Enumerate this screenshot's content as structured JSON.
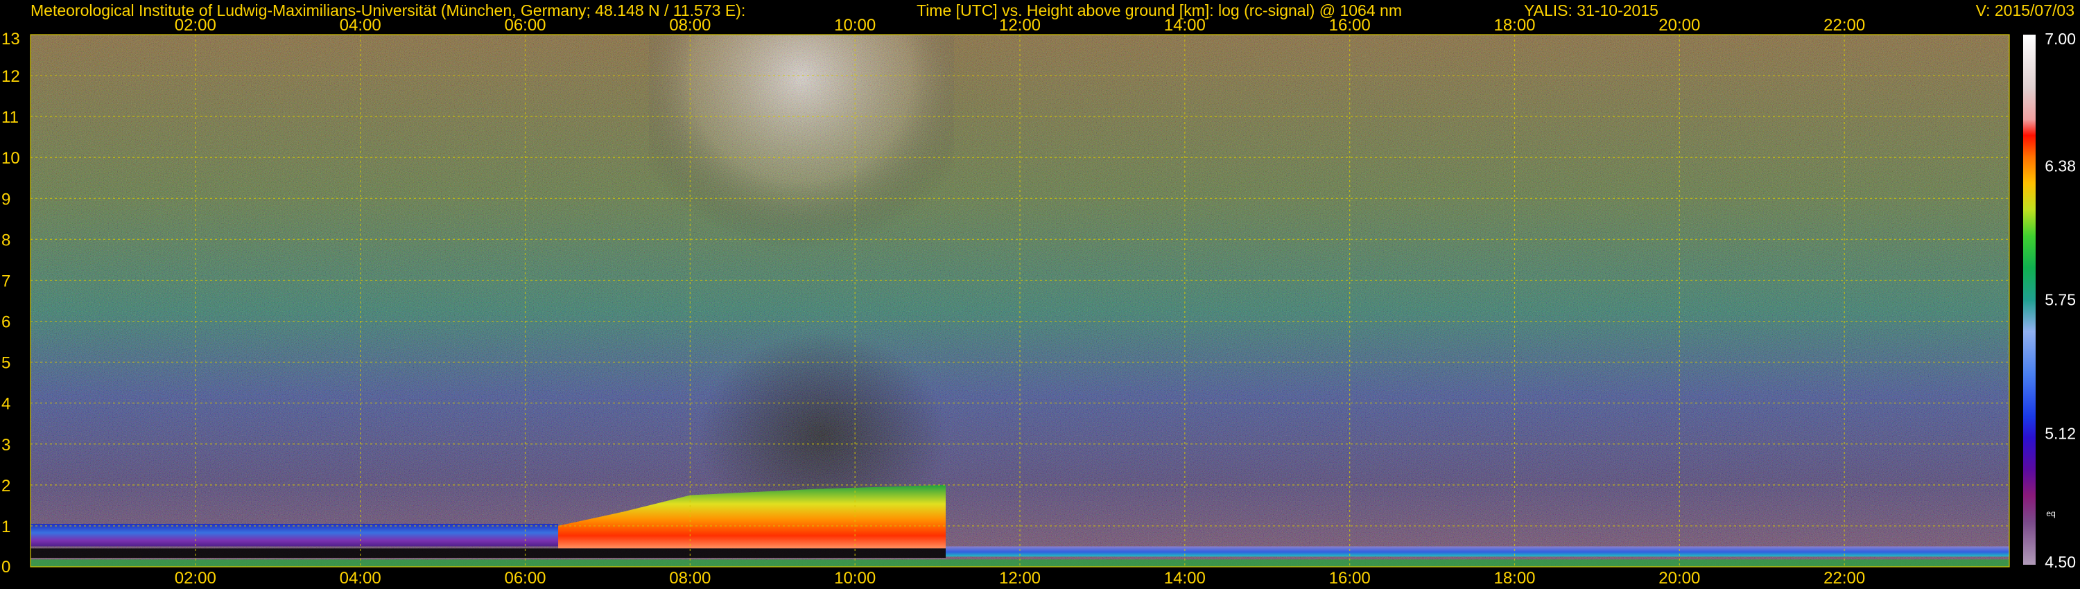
{
  "header": {
    "institute": "Meteorological Institute of Ludwig-Maximilians-Universität (München, Germany; 48.148 N / 11.573 E):",
    "description": "Time [UTC] vs. Height above ground [km]: log (rc-signal) @ 1064 nm",
    "instrument_date": "YALIS: 31-10-2015",
    "version": "V: 2015/07/03"
  },
  "chart_data": {
    "type": "heatmap",
    "title": "Time [UTC] vs. Height above ground [km]: log (rc-signal) @ 1064 nm",
    "xlabel": "Time [UTC]",
    "ylabel": "Height above ground [km]",
    "x_range_hours": [
      0,
      24
    ],
    "y_range_km": [
      0,
      13
    ],
    "x_ticks": [
      "02:00",
      "04:00",
      "06:00",
      "08:00",
      "10:00",
      "12:00",
      "14:00",
      "16:00",
      "18:00",
      "20:00",
      "22:00"
    ],
    "y_ticks": [
      "0",
      "1",
      "2",
      "3",
      "4",
      "5",
      "6",
      "7",
      "8",
      "9",
      "10",
      "11",
      "12",
      "13"
    ],
    "grid": true,
    "colorbar": {
      "range": [
        4.5,
        7.0
      ],
      "ticks": [
        "4.50",
        "5.12",
        "5.75",
        "6.38",
        "7.00"
      ],
      "small_label": "eq"
    },
    "features": [
      {
        "t_start": 0.0,
        "t_end": 6.4,
        "h_bottom": 0.5,
        "h_top": 1.05,
        "level": 5.3
      },
      {
        "t_start": 6.4,
        "t_end": 11.1,
        "h_bottom": 0.45,
        "h_top": 1.9,
        "level": 6.35
      },
      {
        "t_start": 11.1,
        "t_end": 24.0,
        "h_bottom": 0.25,
        "h_top": 0.5,
        "level": 5.55
      }
    ],
    "colors": {
      "axis_text": "#ffd400",
      "grid": "#d8c800",
      "background": "#000000",
      "colorbar_text": "#ffffff"
    }
  }
}
